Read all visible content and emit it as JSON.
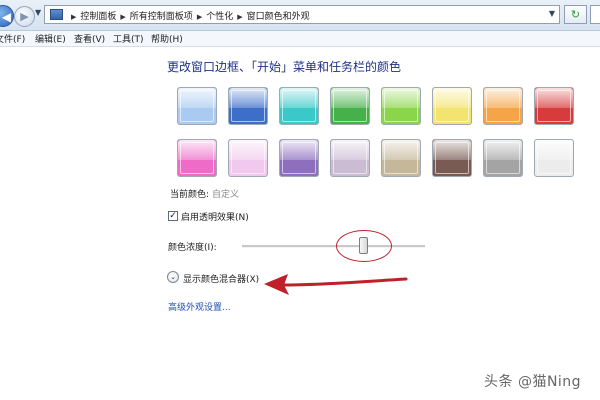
{
  "address_bar": {
    "breadcrumbs": [
      "控制面板",
      "所有控制面板项",
      "个性化",
      "窗口颜色和外观"
    ],
    "refresh_icon": "refresh-icon"
  },
  "menu": {
    "items": [
      "文件(F)",
      "编辑(E)",
      "查看(V)",
      "工具(T)",
      "帮助(H)"
    ]
  },
  "content": {
    "heading": "更改窗口边框、「开始」菜单和任务栏的颜色",
    "swatches": [
      {
        "color": "#a9cbf1"
      },
      {
        "color": "#3d6fc8"
      },
      {
        "color": "#3ac8c8"
      },
      {
        "color": "#46b04a"
      },
      {
        "color": "#8bd54a"
      },
      {
        "color": "#f3e370"
      },
      {
        "color": "#f5a548"
      },
      {
        "color": "#d83b3b"
      },
      {
        "color": "#ee6cc8"
      },
      {
        "color": "#f1c9ee"
      },
      {
        "color": "#8d6fbe"
      },
      {
        "color": "#cbbcd4"
      },
      {
        "color": "#c4b79a"
      },
      {
        "color": "#7a5b54"
      },
      {
        "color": "#a4a4a4"
      },
      {
        "color": "#ececec"
      }
    ],
    "current_color_label": "当前颜色:",
    "current_color_value": "自定义",
    "transparency_label": "启用透明效果(N)",
    "transparency_checked": true,
    "transparency_check_glyph": "✓",
    "intensity_label": "颜色浓度(I):",
    "intensity_percent": 66,
    "mixer_label": "显示颜色混合器(X)",
    "mixer_chevron": "⌄",
    "advanced_link": "高级外观设置...",
    "annotation_color": "#c0202a"
  },
  "watermark": "头条 @猫Ning"
}
